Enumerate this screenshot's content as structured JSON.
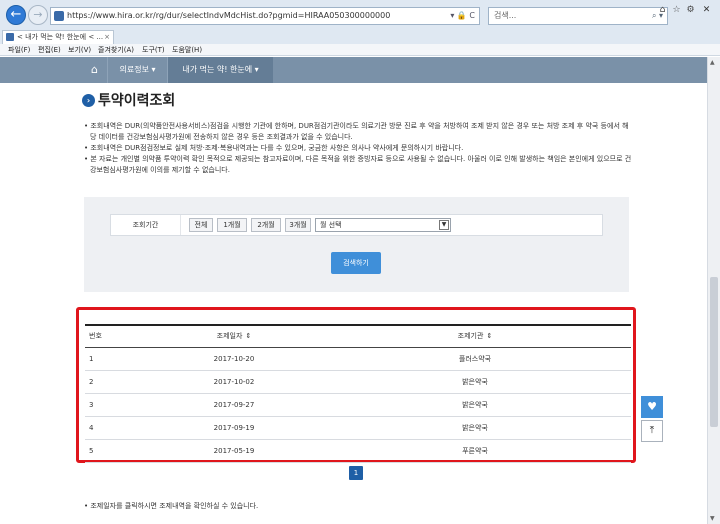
{
  "browser": {
    "url": "https://www.hira.or.kr/rg/dur/selectIndvMdcHist.do?pgmid=HIRAA050300000000",
    "search_placeholder": "검색...",
    "tab_title": "< 내가 먹는 약! 한눈에 < ...",
    "menu": [
      "파일(F)",
      "편집(E)",
      "보기(V)",
      "즐겨찾기(A)",
      "도구(T)",
      "도움말(H)"
    ]
  },
  "gnb": {
    "menu1": "의료정보",
    "menu2": "내가 먹는 약! 한눈에"
  },
  "page": {
    "title": "투약이력조회",
    "notes": [
      "• 조회내역은 DUR(의약품안전사용서비스)점검을 시행한 기관에 한하며, DUR점검기관이라도 의료기관 방문 진료 후 약을 처방하여 조제 받지 않은 경우 또는 처방 조제 후 약국 등에서 해당 데이터를 건강보험심사평가원에 전송하지 않은 경우 등은 조회결과가 없을 수 있습니다.",
      "• 조회내역은 DUR점검정보로 실제 처방·조제·복용내역과는 다를 수 있으며, 궁금한 사항은 의사나 약사에게 문의하시기 바랍니다.",
      "• 본 자료는 개인별 의약품 투약이력 확인 목적으로 제공되는 참고자료이며, 다른 목적을 위한 증빙자료 등으로 사용될 수 없습니다. 아울러 이로 인해 발생하는 책임은 본인에게 있으므로 건강보험심사평가원에 이의를 제기할 수 없습니다."
    ],
    "footnote": "• 조제일자를 클릭하시면 조제내역을 확인하실 수 있습니다."
  },
  "filter": {
    "label": "조회기간",
    "buttons": [
      "전체",
      "1개월",
      "2개월",
      "3개월"
    ],
    "month_select": "월 선택",
    "search_button": "검색하기"
  },
  "table": {
    "headers": {
      "no": "번호",
      "date": "조제일자",
      "org": "조제기관"
    },
    "rows": [
      {
        "no": "1",
        "date": "2017-10-20",
        "org": "플러스약국"
      },
      {
        "no": "2",
        "date": "2017-10-02",
        "org": "밝은약국"
      },
      {
        "no": "3",
        "date": "2017-09-27",
        "org": "밝은약국"
      },
      {
        "no": "4",
        "date": "2017-09-19",
        "org": "밝은약국"
      },
      {
        "no": "5",
        "date": "2017-05-19",
        "org": "푸른약국"
      }
    ]
  },
  "pagination": {
    "current": "1"
  },
  "icons": {
    "back": "back-arrow-icon",
    "forward": "forward-arrow-icon",
    "home": "home-icon",
    "heart": "heart-icon",
    "top": "scroll-top-icon"
  },
  "colors": {
    "highlight_frame": "#e0161c",
    "gnb": "#7a91a8",
    "primary_button": "#3f8fd9",
    "title_dot": "#1f5fa6"
  }
}
